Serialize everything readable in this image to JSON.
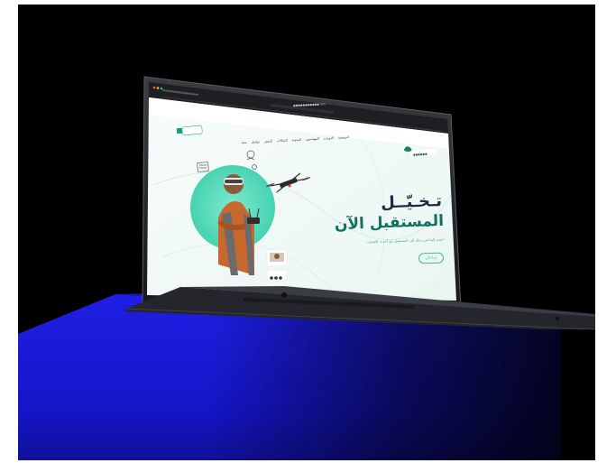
{
  "scene": {
    "description_colors": {
      "background": "#000000",
      "pedestal": "#1a1ae0",
      "laptop_body": "#2a2c31",
      "screen_bg": "#f3fbf8",
      "accent": "#3bd1ad"
    }
  },
  "website": {
    "url": "●●●●●●●●●●●.com",
    "brand": "●●●●●●",
    "nav": "الرئيسية  الدورات  المهندسين  المدونة  المقالات  المتجر  تواصل معنا",
    "hero_title_line1": "تـخـيّــل",
    "hero_title_line2": "المستقبل الآن",
    "hero_subtitle": "انضم إلينا في رحلة إلى المستقبل مع أحدث التقنيات",
    "cta_label": "ابدأ الآن"
  }
}
